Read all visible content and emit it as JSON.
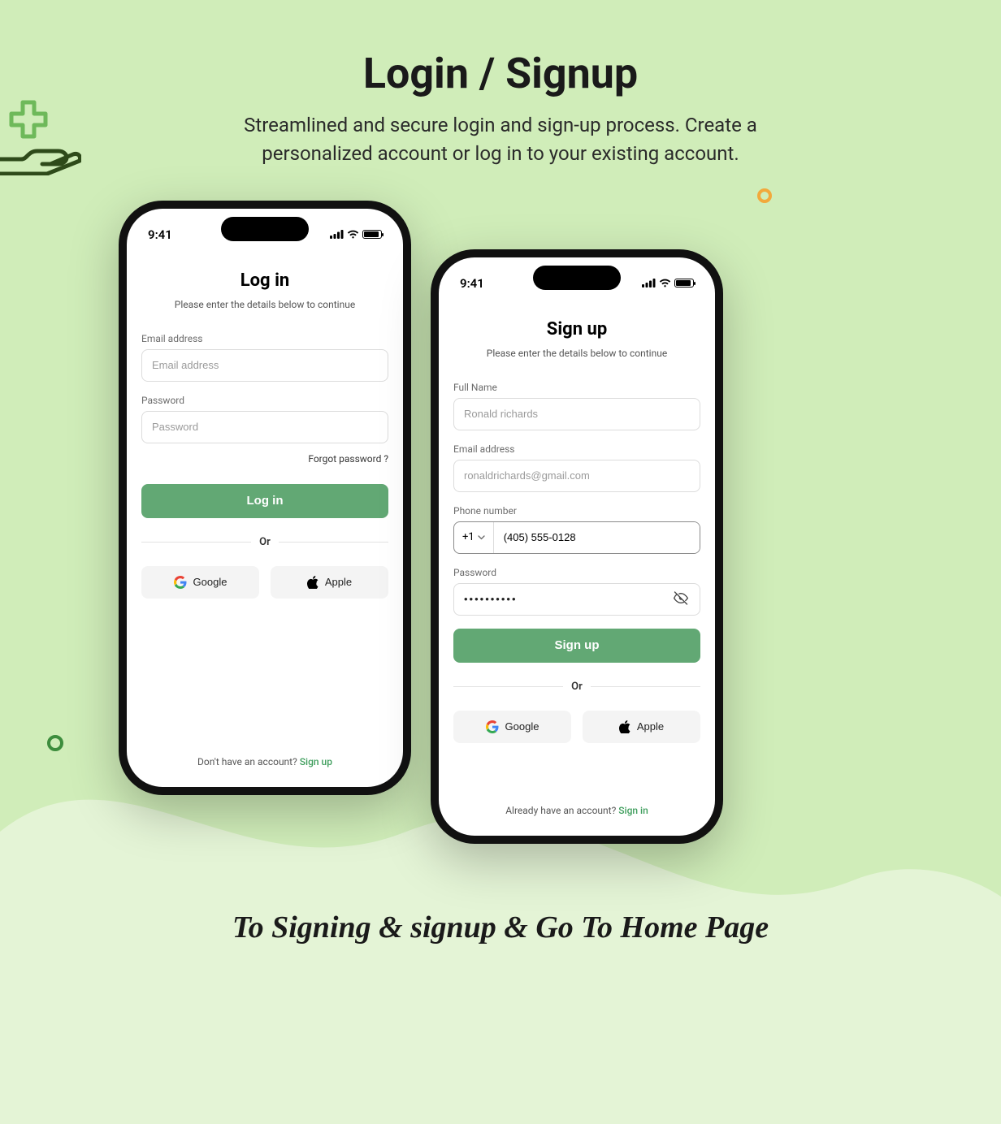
{
  "page": {
    "title": "Login / Signup",
    "subtitle": "Streamlined and secure login and sign-up process. Create a personalized account or log in to your existing account.",
    "caption": "To Signing & signup & Go To Home Page"
  },
  "status": {
    "time": "9:41"
  },
  "login": {
    "title": "Log in",
    "subtitle": "Please enter the details below to continue",
    "email_label": "Email address",
    "email_placeholder": "Email address",
    "password_label": "Password",
    "password_placeholder": "Password",
    "forgot": "Forgot password ?",
    "button": "Log in",
    "or": "Or",
    "google": "Google",
    "apple": "Apple",
    "footer_text": "Don't have an account? ",
    "footer_link": "Sign up"
  },
  "signup": {
    "title": "Sign up",
    "subtitle": "Please enter the details below to continue",
    "name_label": "Full Name",
    "name_placeholder": "Ronald richards",
    "email_label": "Email address",
    "email_placeholder": "ronaldrichards@gmail.com",
    "phone_label": "Phone number",
    "country_code": "+1",
    "phone_value": "(405) 555-0128",
    "password_label": "Password",
    "password_value": "••••••••••",
    "button": "Sign up",
    "or": "Or",
    "google": "Google",
    "apple": "Apple",
    "footer_text": "Already have an account? ",
    "footer_link": "Sign in"
  },
  "colors": {
    "background": "#d0edb9",
    "primary": "#62a874",
    "link": "#3f9e5d"
  }
}
